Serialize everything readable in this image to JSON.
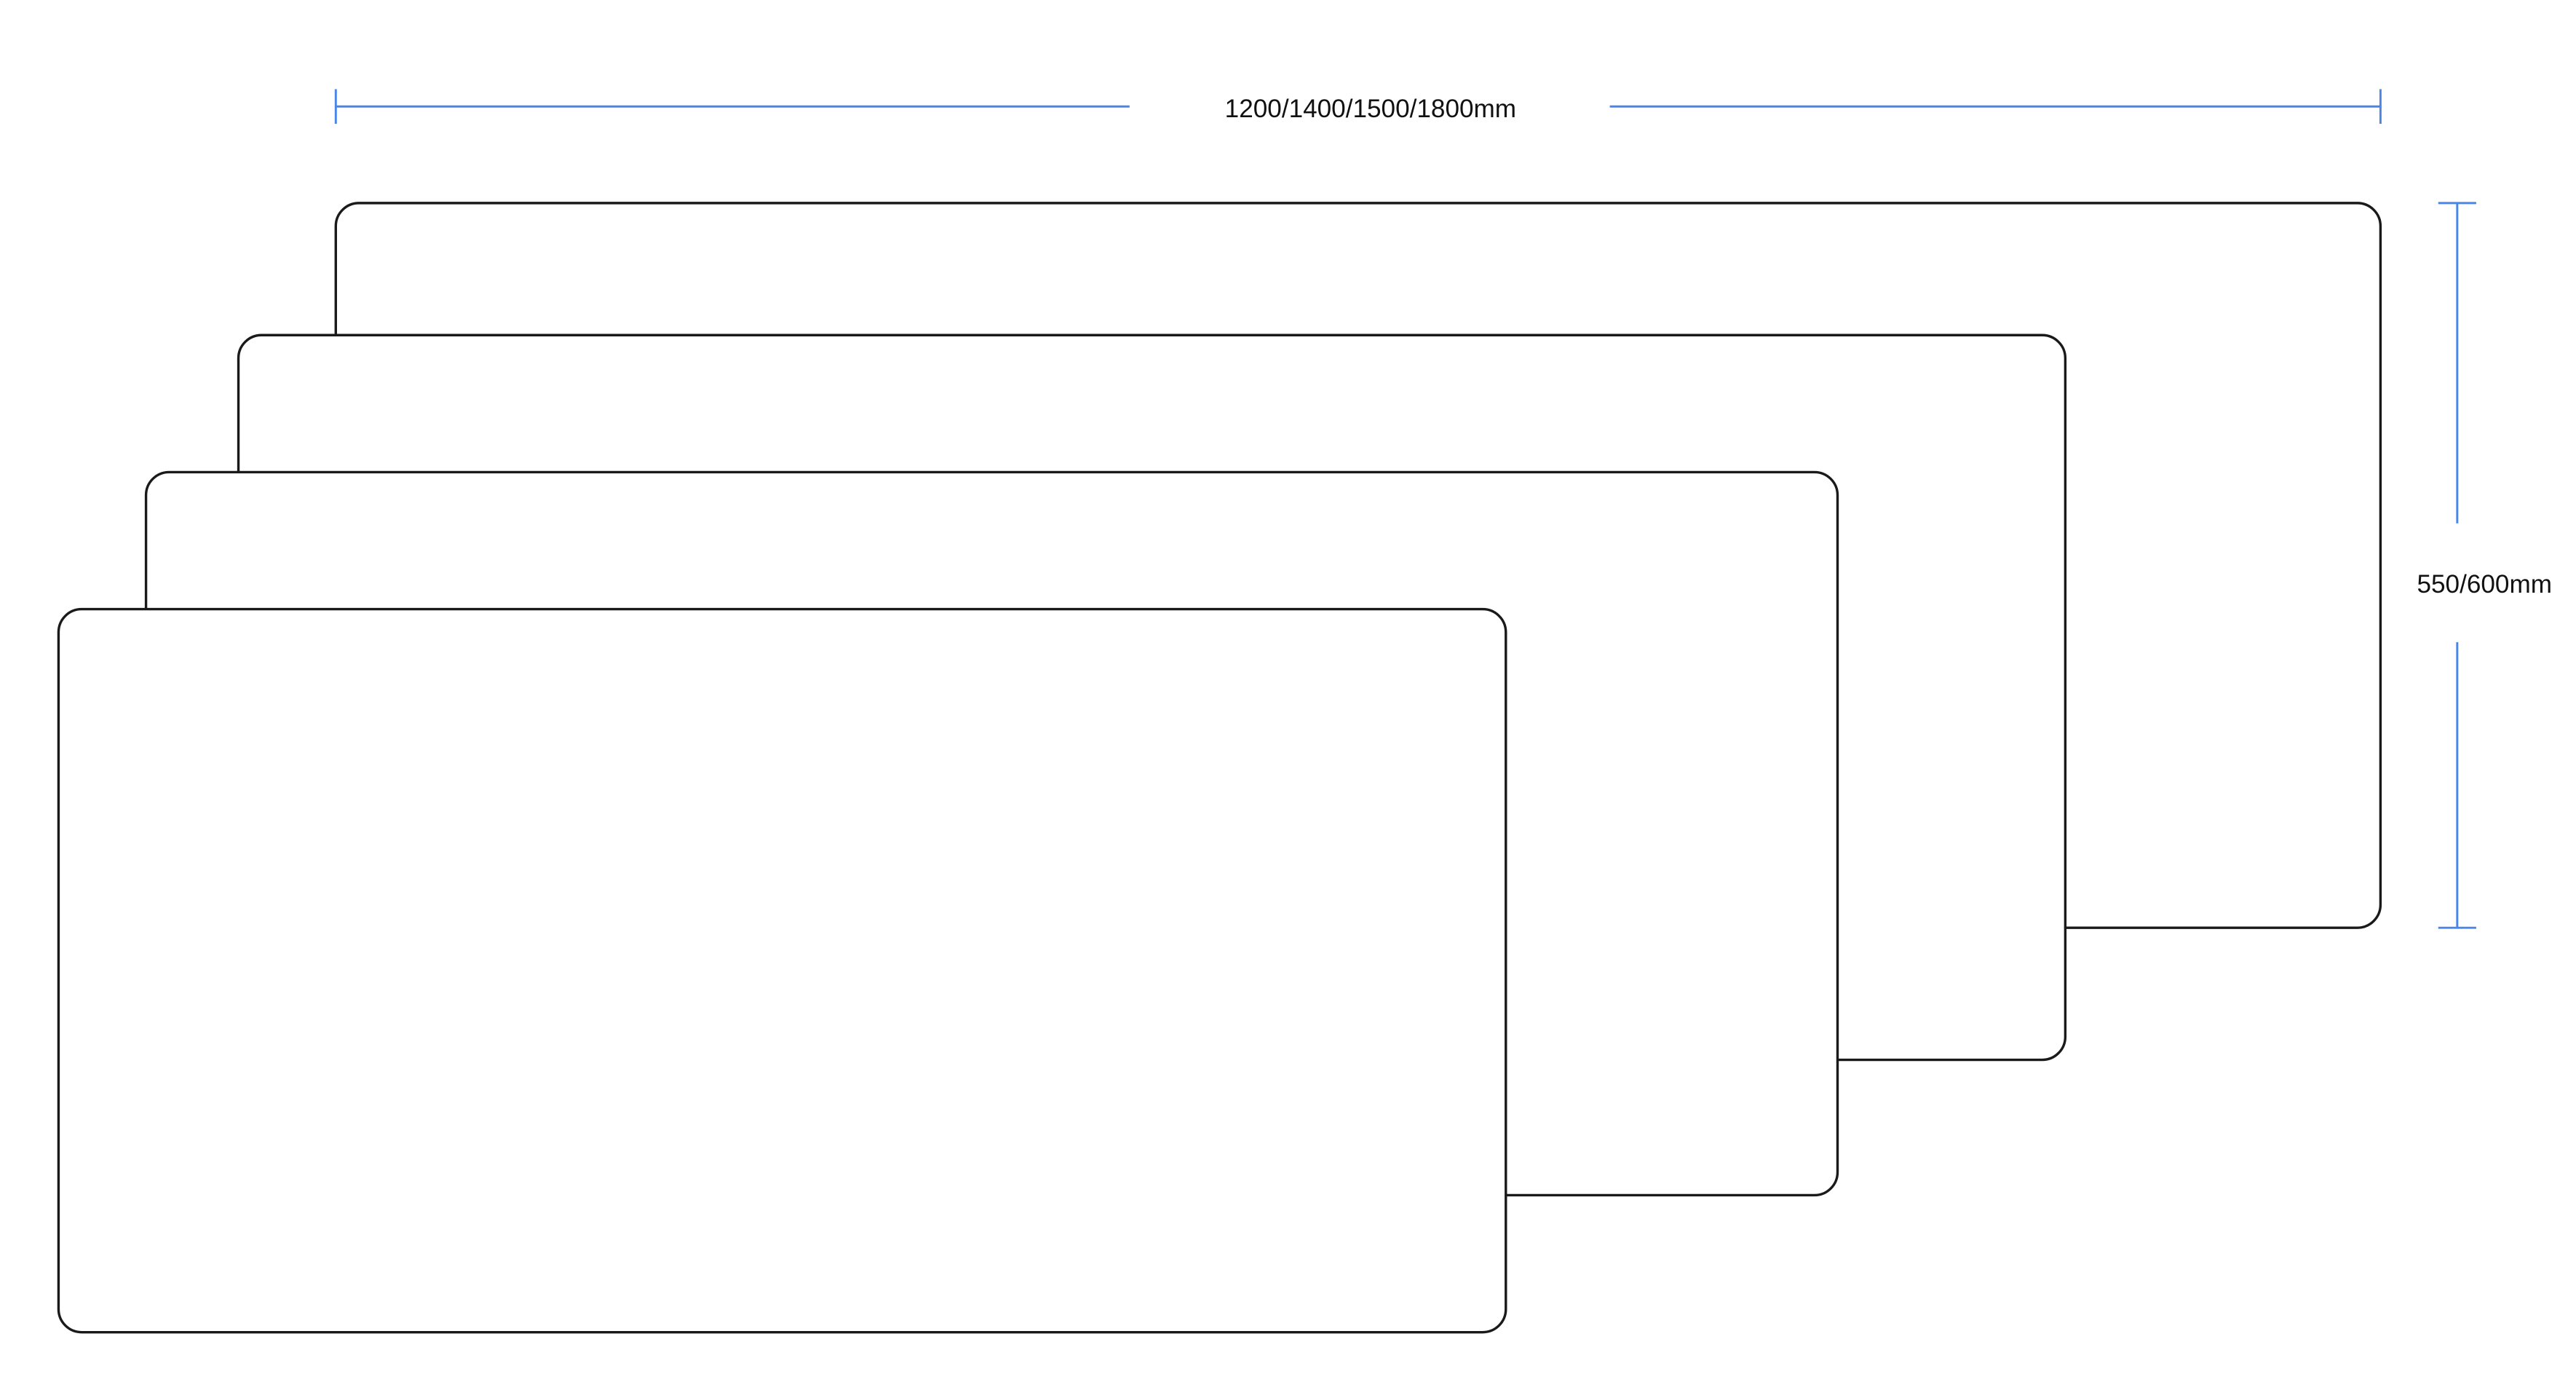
{
  "dimensions": {
    "width_label": "1200/1400/1500/1800mm",
    "depth_label": "550/600mm"
  },
  "colors": {
    "outline": "#1a1a1a",
    "dimension_line": "#4a86e8",
    "background": "#ffffff"
  }
}
